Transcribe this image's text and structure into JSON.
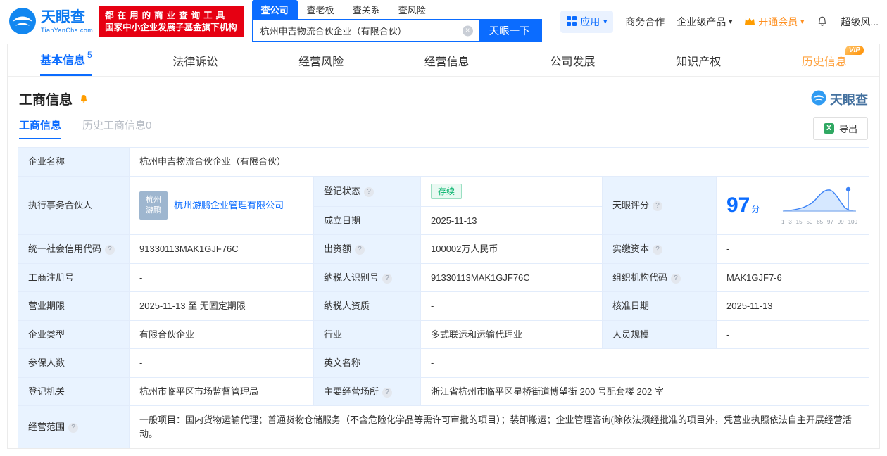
{
  "icons": {
    "caret_down": "▾",
    "help": "?",
    "clear": "×",
    "excel": "X"
  },
  "header": {
    "logo": {
      "title": "天眼查",
      "subtitle": "TianYanCha.com"
    },
    "promo": {
      "line1": "都在用的商业查询工具",
      "line2": "国家中小企业发展子基金旗下机构"
    },
    "search": {
      "tabs": [
        {
          "label": "查公司",
          "active": true
        },
        {
          "label": "查老板",
          "active": false
        },
        {
          "label": "查关系",
          "active": false
        },
        {
          "label": "查风险",
          "active": false
        }
      ],
      "value": "杭州申吉物流合伙企业（有限合伙）",
      "button": "天眼一下"
    },
    "menu": {
      "apps": "应用",
      "cooperation": "商务合作",
      "products": "企业级产品",
      "vip": "开通会员",
      "risk": "超级风..."
    }
  },
  "nav_tabs": [
    {
      "label": "基本信息",
      "count": "5"
    },
    {
      "label": "法律诉讼"
    },
    {
      "label": "经营风险"
    },
    {
      "label": "经营信息"
    },
    {
      "label": "公司发展"
    },
    {
      "label": "知识产权"
    },
    {
      "label": "历史信息",
      "badge": "VIP"
    }
  ],
  "section": {
    "title": "工商信息",
    "brand": "天眼查",
    "subtabs": [
      {
        "label": "工商信息"
      },
      {
        "label": "历史工商信息0"
      }
    ],
    "export": "导出"
  },
  "biz": {
    "labels": {
      "company_name": "企业名称",
      "partner": "执行事务合伙人",
      "reg_status": "登记状态",
      "establish_date": "成立日期",
      "score": "天眼评分",
      "credit_code": "统一社会信用代码",
      "capital": "出资额",
      "paid_capital": "实缴资本",
      "reg_number": "工商注册号",
      "taxpayer_id": "纳税人识别号",
      "org_code": "组织机构代码",
      "business_term": "营业期限",
      "taxpayer_quality": "纳税人资质",
      "approval_date": "核准日期",
      "company_type": "企业类型",
      "industry": "行业",
      "staff_size": "人员规模",
      "insured": "参保人数",
      "english_name": "英文名称",
      "reg_authority": "登记机关",
      "business_site": "主要经营场所",
      "business_scope": "经营范围"
    },
    "values": {
      "company_name": "杭州申吉物流合伙企业（有限合伙）",
      "partner_logo_line1": "杭州",
      "partner_logo_line2": "游鹏",
      "partner_name": "杭州游鹏企业管理有限公司",
      "reg_status": "存续",
      "establish_date": "2025-11-13",
      "score": "97",
      "score_unit": "分",
      "credit_code": "91330113MAK1GJF76C",
      "capital": "100002万人民币",
      "paid_capital": "-",
      "reg_number": "-",
      "taxpayer_id": "91330113MAK1GJF76C",
      "org_code": "MAK1GJF7-6",
      "business_term": "2025-11-13 至 无固定期限",
      "taxpayer_quality": "-",
      "approval_date": "2025-11-13",
      "company_type": "有限合伙企业",
      "industry": "多式联运和运输代理业",
      "staff_size": "-",
      "insured": "-",
      "english_name": "-",
      "reg_authority": "杭州市临平区市场监督管理局",
      "business_site": "浙江省杭州市临平区星桥街道博望街 200 号配套楼 202 室",
      "business_scope": "一般项目：国内货物运输代理；普通货物仓储服务（不含危险化学品等需许可审批的项目）；装卸搬运；企业管理咨询(除依法须经批准的项目外，凭营业执照依法自主开展经营活动。"
    },
    "score_ticks": [
      "1",
      "3",
      "15",
      "50",
      "85",
      "97",
      "99",
      "100"
    ]
  }
}
